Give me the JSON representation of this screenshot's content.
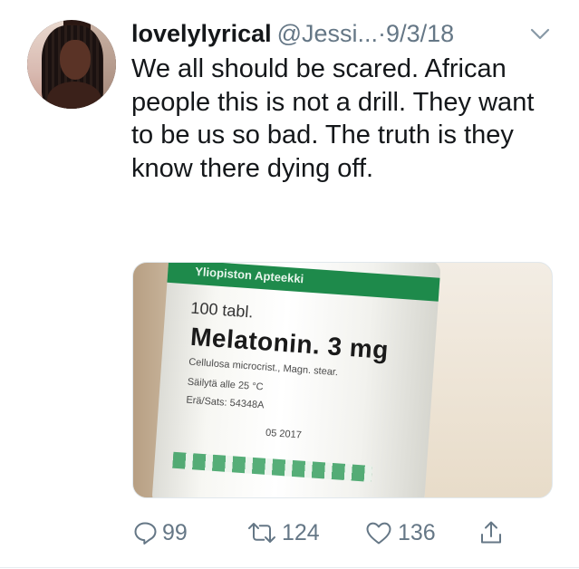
{
  "tweet": {
    "author_name": "lovelylyrical",
    "author_handle": "@Jessi...",
    "separator": "·",
    "timestamp": "9/3/18",
    "text": "We all should be scared. African people this is not a drill. They want to be us so bad. The truth is they know there dying off.",
    "media": {
      "label_band": "Yliopiston Apteekki",
      "tablet_count": "100 tabl.",
      "drug_name": "Melatonin. 3 mg",
      "line1": "Cellulosa microcrist., Magn. stear.",
      "line2": "Säilytä alle 25 °C",
      "line3": "Erä/Sats: 54348A",
      "line4": "05 2017"
    },
    "actions": {
      "reply_count": "99",
      "retweet_count": "124",
      "like_count": "136"
    }
  },
  "colors": {
    "text": "#14171a",
    "secondary": "#657786",
    "divider": "#e6ecf0"
  },
  "icons": [
    "chevron-down-icon",
    "reply-icon",
    "retweet-icon",
    "heart-icon",
    "share-icon"
  ]
}
